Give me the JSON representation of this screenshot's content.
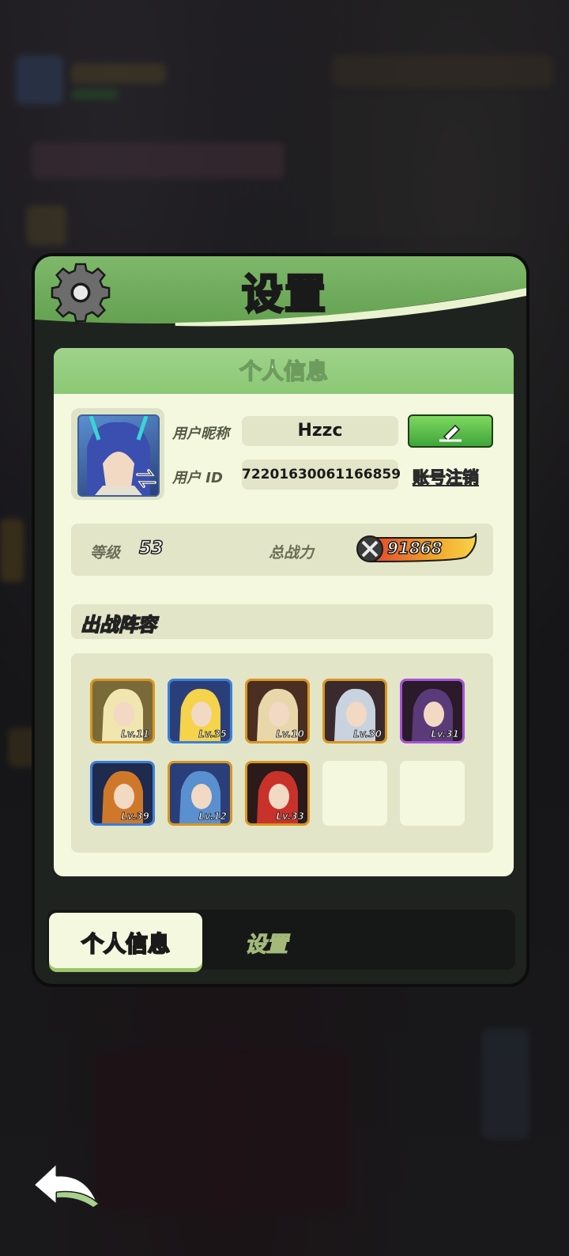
{
  "panel": {
    "title": "设置",
    "icon": "gear-icon"
  },
  "profile": {
    "card_title": "个人信息",
    "nickname_label": "用户昵称",
    "nickname": "Hzzc",
    "id_label": "用户  ID",
    "user_id": "72201630061166859",
    "cancel_account": "账号注销",
    "level_label": "等级",
    "level": "53",
    "power_label": "总战力",
    "power": "91868"
  },
  "team": {
    "title": "出战阵容",
    "heroes": [
      {
        "level": "Lv.11",
        "frame": "gold",
        "colors": [
          "#f2e6b0",
          "#7a6a3a"
        ]
      },
      {
        "level": "Lv.35",
        "frame": "blue",
        "colors": [
          "#f5d34a",
          "#2a3f7a"
        ]
      },
      {
        "level": "Lv.10",
        "frame": "gold",
        "colors": [
          "#e8d7a8",
          "#4a2e22"
        ]
      },
      {
        "level": "Lv.30",
        "frame": "gold",
        "colors": [
          "#c9d3e0",
          "#3a2a2e"
        ]
      },
      {
        "level": "Lv.31",
        "frame": "purple",
        "colors": [
          "#5a3a78",
          "#2a1a2a"
        ]
      },
      {
        "level": "Lv.39",
        "frame": "blue",
        "colors": [
          "#d0782a",
          "#1e2a4e"
        ]
      },
      {
        "level": "Lv.12",
        "frame": "gold",
        "colors": [
          "#5a8fd0",
          "#2a3f7a"
        ]
      },
      {
        "level": "Lv.33",
        "frame": "gold",
        "colors": [
          "#c8322a",
          "#2a1a1a"
        ]
      },
      {
        "level": "",
        "frame": "empty"
      },
      {
        "level": "",
        "frame": "empty"
      }
    ]
  },
  "tabs": {
    "active": "个人信息",
    "inactive": "设置"
  }
}
